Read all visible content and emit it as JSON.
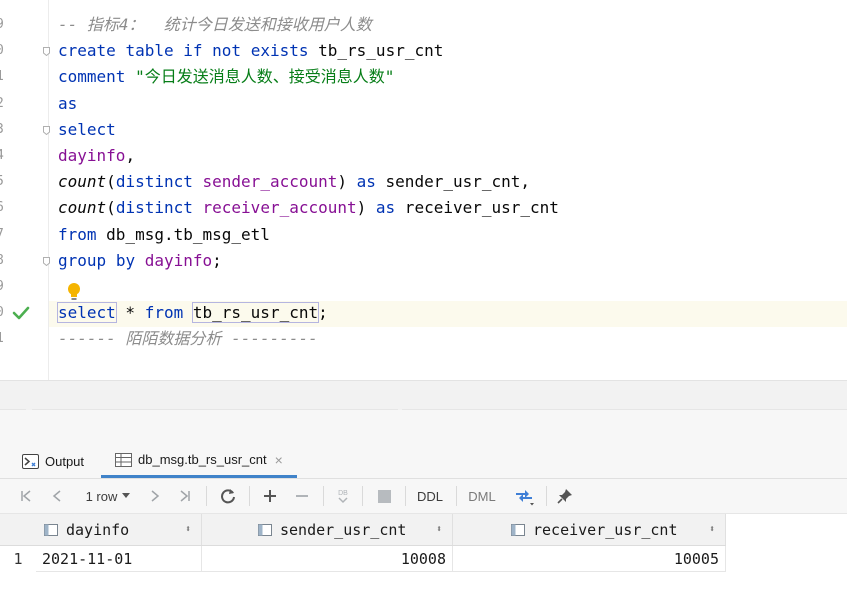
{
  "editor": {
    "line_numbers": [
      "9",
      "0",
      "1",
      "2",
      "3",
      "4",
      "5",
      "6",
      "7",
      "8",
      "9",
      "0",
      "1"
    ],
    "lines": [
      [
        {
          "t": "-- 指标4：  统计今日发送和接收用户人数",
          "c": "cmt"
        }
      ],
      [
        {
          "t": "create",
          "c": "kw"
        },
        {
          "t": " "
        },
        {
          "t": "table",
          "c": "kw"
        },
        {
          "t": " "
        },
        {
          "t": "if",
          "c": "kw"
        },
        {
          "t": " "
        },
        {
          "t": "not",
          "c": "kw"
        },
        {
          "t": " "
        },
        {
          "t": "exists",
          "c": "kw"
        },
        {
          "t": " tb_rs_usr_cnt"
        }
      ],
      [
        {
          "t": "comment",
          "c": "kw"
        },
        {
          "t": " "
        },
        {
          "t": "\"今日发送消息人数、接受消息人数\"",
          "c": "str"
        }
      ],
      [
        {
          "t": "as",
          "c": "kw"
        }
      ],
      [
        {
          "t": "select",
          "c": "kw"
        }
      ],
      [
        {
          "t": "dayinfo",
          "c": "id"
        },
        {
          "t": ","
        }
      ],
      [
        {
          "t": "count",
          "c": "fn"
        },
        {
          "t": "("
        },
        {
          "t": "distinct",
          "c": "kw"
        },
        {
          "t": " "
        },
        {
          "t": "sender_account",
          "c": "id"
        },
        {
          "t": ") "
        },
        {
          "t": "as",
          "c": "kw"
        },
        {
          "t": " sender_usr_cnt,"
        }
      ],
      [
        {
          "t": "count",
          "c": "fn"
        },
        {
          "t": "("
        },
        {
          "t": "distinct",
          "c": "kw"
        },
        {
          "t": " "
        },
        {
          "t": "receiver_account",
          "c": "id"
        },
        {
          "t": ") "
        },
        {
          "t": "as",
          "c": "kw"
        },
        {
          "t": " receiver_usr_cnt"
        }
      ],
      [
        {
          "t": "from",
          "c": "kw"
        },
        {
          "t": " db_msg.tb_msg_etl"
        }
      ],
      [
        {
          "t": "group",
          "c": "kw"
        },
        {
          "t": " "
        },
        {
          "t": "by",
          "c": "kw"
        },
        {
          "t": " "
        },
        {
          "t": "dayinfo",
          "c": "id"
        },
        {
          "t": ";"
        }
      ],
      [],
      [
        {
          "t": "select",
          "c": "kw cur"
        },
        {
          "t": " * "
        },
        {
          "t": "from",
          "c": "kw"
        },
        {
          "t": " "
        },
        {
          "t": "tb_rs_usr_cnt",
          "c": "cur"
        },
        {
          "t": ";"
        }
      ],
      [
        {
          "t": "------ 陌陌数据分析 ---------",
          "c": "cmt"
        }
      ]
    ]
  },
  "tabs": {
    "output_label": "Output",
    "result_label": "db_msg.tb_rs_usr_cnt",
    "close_glyph": "×"
  },
  "toolbar": {
    "row_count": "1 row",
    "ddl_label": "DDL",
    "dml_label": "DML",
    "db_badge": "DB"
  },
  "grid": {
    "columns": [
      "dayinfo",
      "sender_usr_cnt",
      "receiver_usr_cnt"
    ],
    "sort_glyph": "⬍",
    "rows": [
      {
        "num": "1",
        "cells": [
          "2021-11-01",
          "10008",
          "10005"
        ]
      }
    ]
  },
  "colors": {
    "keyword": "#0033b3",
    "identifier": "#871094",
    "string": "#067d17",
    "comment": "#8c8c8c",
    "active_tab_underline": "#4083c9",
    "success_check": "#4caf50"
  }
}
